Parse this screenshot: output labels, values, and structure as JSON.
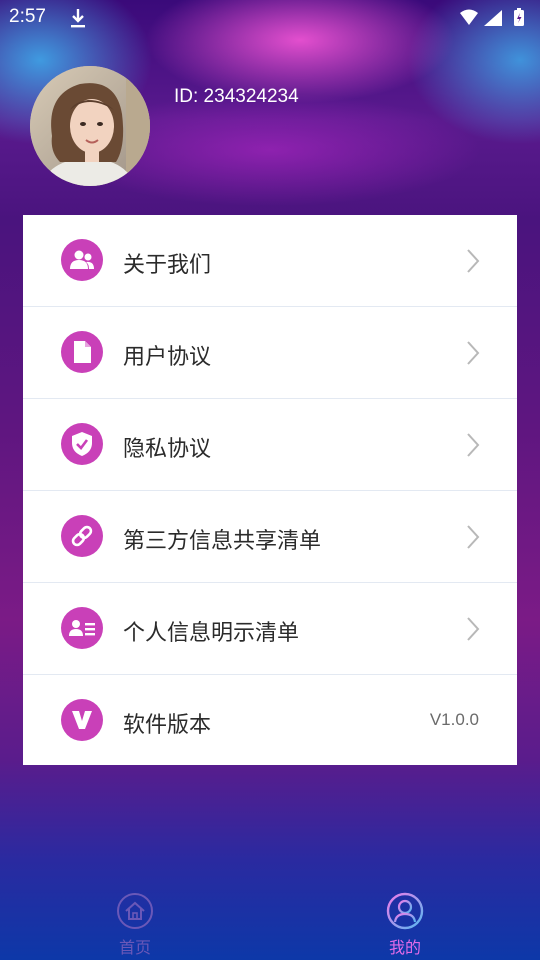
{
  "status_bar": {
    "time": "2:57",
    "icons": [
      "download-icon",
      "wifi-icon",
      "signal-icon",
      "battery-icon"
    ]
  },
  "profile": {
    "id_text": "ID: 234324234"
  },
  "menu": {
    "items": [
      {
        "label": "关于我们",
        "icon": "users-icon"
      },
      {
        "label": "用户协议",
        "icon": "document-icon"
      },
      {
        "label": "隐私协议",
        "icon": "shield-icon"
      },
      {
        "label": "第三方信息共享清单",
        "icon": "link-icon"
      },
      {
        "label": "个人信息明示清单",
        "icon": "id-card-icon"
      },
      {
        "label": "软件版本",
        "icon": "v-icon",
        "value": "V1.0.0"
      }
    ]
  },
  "bottom_nav": {
    "tabs": [
      {
        "label": "首页",
        "icon": "home-icon",
        "active": false
      },
      {
        "label": "我的",
        "icon": "user-icon",
        "active": true
      }
    ]
  },
  "colors": {
    "accent": "#c940b8",
    "card_background": "#ffffff",
    "active_tab": "#e26be8",
    "inactive_tab": "#6a58b8"
  }
}
